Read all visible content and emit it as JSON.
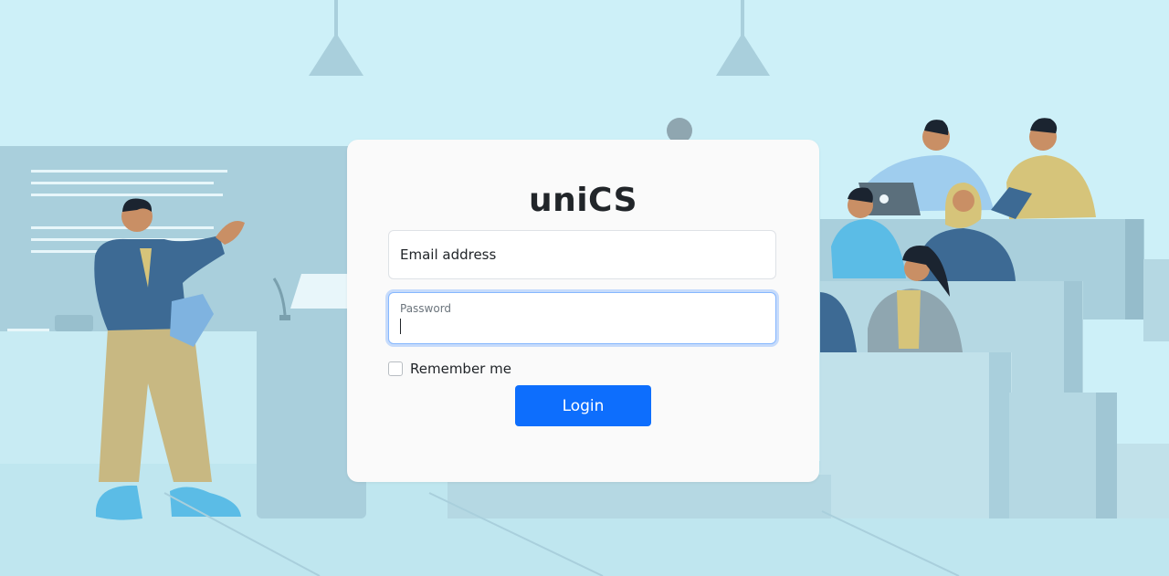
{
  "app": {
    "brand": "uniCS"
  },
  "login_form": {
    "email_placeholder": "Email address",
    "password_label": "Password",
    "password_value": "",
    "remember_label": "Remember me",
    "remember_checked": false,
    "login_label": "Login"
  },
  "colors": {
    "background": "#cdf0f8",
    "card": "#fafafa",
    "primary": "#0d6efd",
    "focus_border": "#86b7fe"
  }
}
